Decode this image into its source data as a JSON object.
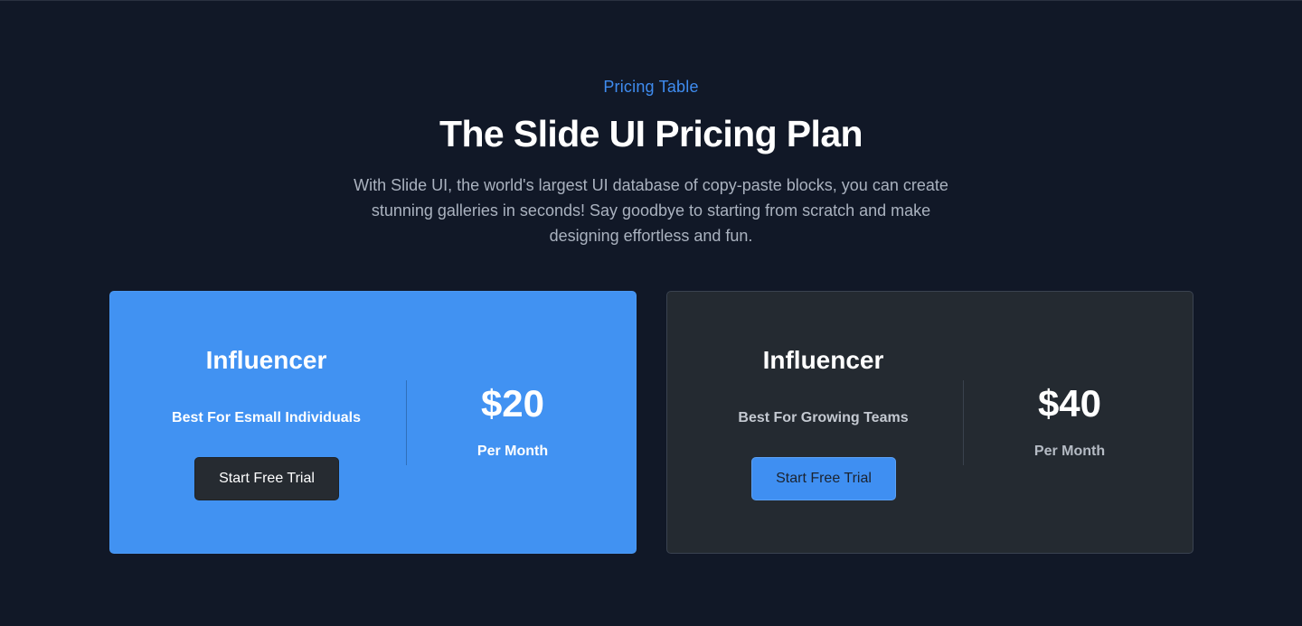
{
  "header": {
    "eyebrow": "Pricing Table",
    "title": "The Slide UI Pricing Plan",
    "description": "With Slide UI, the world's largest UI database of copy-paste blocks, you can create stunning galleries in seconds! Say goodbye to starting from scratch and make designing effortless and fun."
  },
  "plans": [
    {
      "name": "Influencer",
      "subtitle": "Best For Esmall Individuals",
      "cta": "Start Free Trial",
      "price": "$20",
      "period": "Per Month",
      "accent": "#4192f2"
    },
    {
      "name": "Influencer",
      "subtitle": "Best For Growing Teams",
      "cta": "Start Free Trial",
      "price": "$40",
      "period": "Per Month",
      "accent": "#242a31"
    }
  ],
  "colors": {
    "background": "#111827",
    "accent": "#3f8cf0",
    "text_primary": "#ffffff",
    "text_muted": "#aab2bf"
  }
}
